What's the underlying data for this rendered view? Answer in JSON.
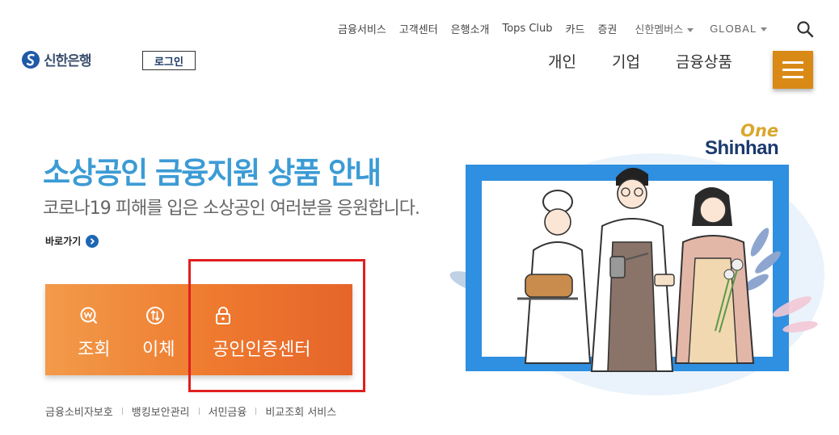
{
  "util_nav": {
    "items": [
      "금융서비스",
      "고객센터",
      "은행소개",
      "Tops Club",
      "카드",
      "증권"
    ],
    "member": "신한멤버스",
    "global": "GLOBAL"
  },
  "logo": {
    "text": "신한은행"
  },
  "login": {
    "label": "로그인"
  },
  "main_nav": {
    "items": [
      "개인",
      "기업",
      "금융상품"
    ]
  },
  "hero": {
    "title": "소상공인 금융지원 상품 안내",
    "subtitle": "코로나19 피해를 입은 소상공인 여러분을 응원합니다.",
    "shortcut": "바로가기"
  },
  "actions": [
    {
      "label": "조회",
      "icon": "won-search-icon"
    },
    {
      "label": "이체",
      "icon": "transfer-icon"
    },
    {
      "label": "공인인증센터",
      "icon": "lock-icon"
    }
  ],
  "footer_links": [
    "금융소비자보호",
    "뱅킹보안관리",
    "서민금융",
    "비교조회 서비스"
  ],
  "brand": {
    "one": "One",
    "shinhan": "Shinhan"
  },
  "colors": {
    "accent_blue": "#3c9bd5",
    "brand_navy": "#1b3a6e",
    "menu_gold": "#d98916",
    "action_orange": "#ee7a2f",
    "highlight_red": "#e0201f"
  }
}
